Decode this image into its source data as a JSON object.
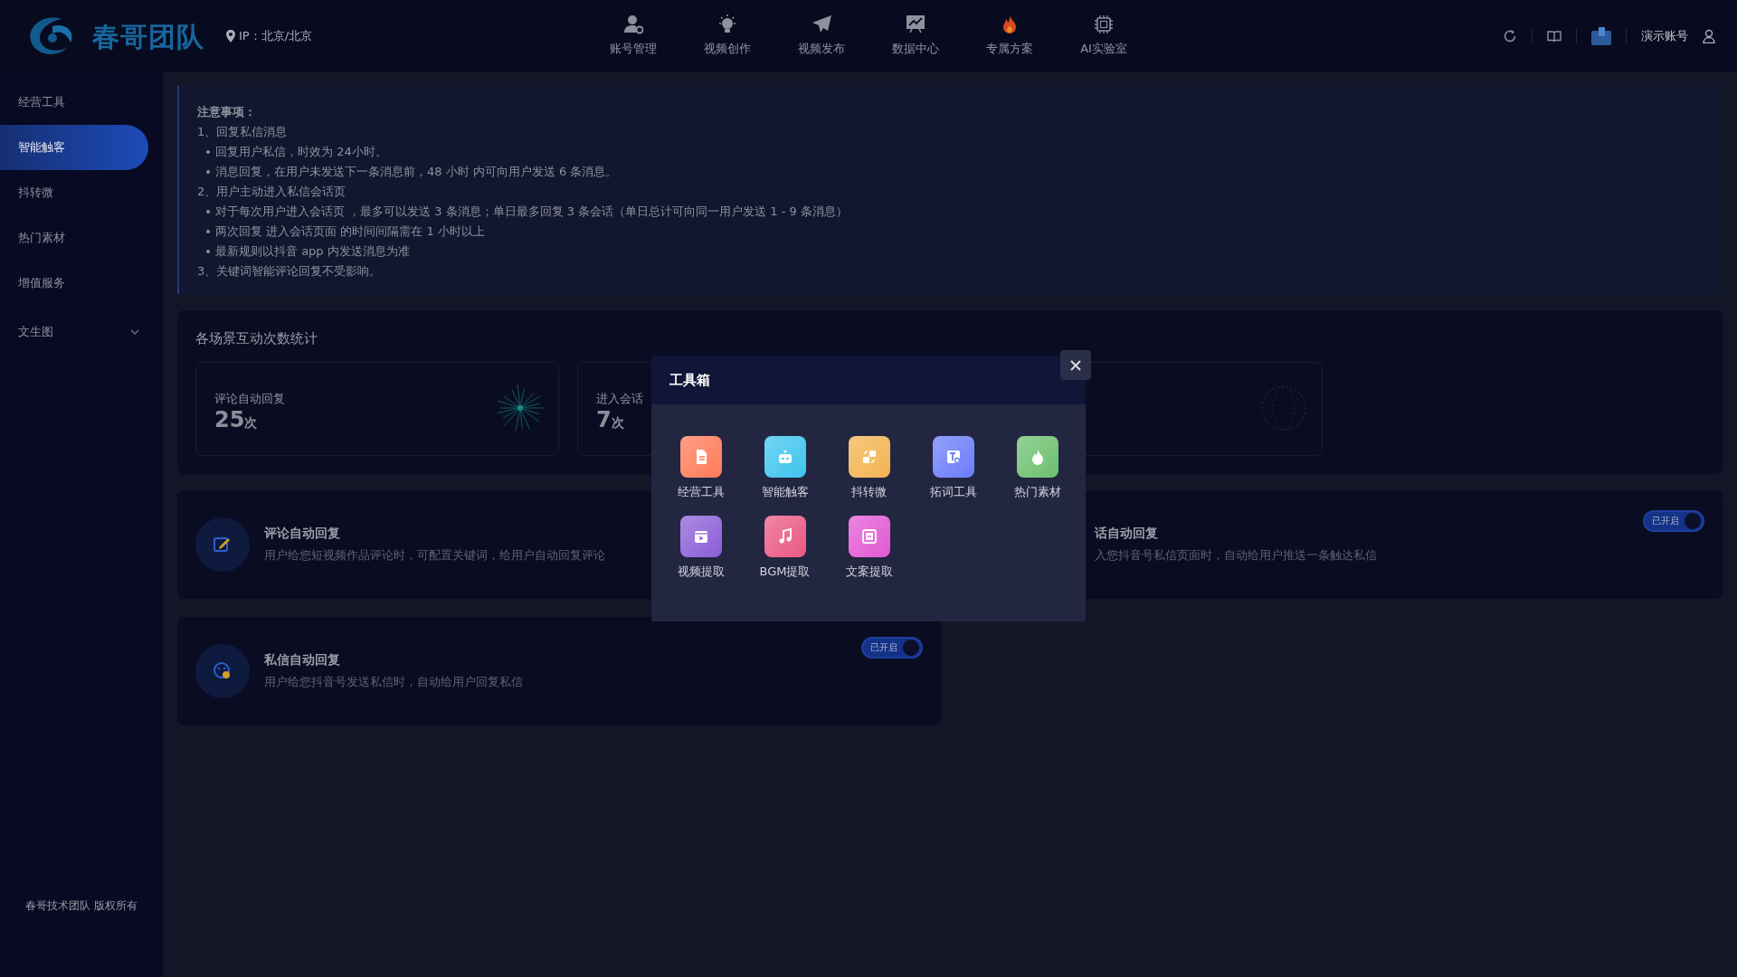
{
  "header": {
    "logo_text": "春哥团队",
    "ip": "IP：北京/北京",
    "nav": [
      {
        "label": "账号管理"
      },
      {
        "label": "视频创作"
      },
      {
        "label": "视频发布"
      },
      {
        "label": "数据中心"
      },
      {
        "label": "专属方案"
      },
      {
        "label": "AI实验室"
      }
    ],
    "account": "演示账号"
  },
  "sidebar": {
    "items": [
      {
        "label": "经营工具",
        "selected": false
      },
      {
        "label": "智能触客",
        "selected": true
      },
      {
        "label": "抖转微",
        "selected": false
      },
      {
        "label": "热门素材",
        "selected": false
      },
      {
        "label": "增值服务",
        "selected": false
      },
      {
        "label": "文生图",
        "selected": false,
        "expanded": false
      }
    ],
    "footer": "春哥技术团队 版权所有"
  },
  "notice": {
    "title": "注意事项：",
    "lines": [
      {
        "kind": "heading",
        "text": "1、回复私信消息"
      },
      {
        "kind": "bullet",
        "text": "回复用户私信，时效为 24小时。"
      },
      {
        "kind": "bullet",
        "text": "消息回复，在用户未发送下一条消息前，48 小时 内可向用户发送 6 条消息。"
      },
      {
        "kind": "heading",
        "text": "2、用户主动进入私信会话页"
      },
      {
        "kind": "bullet",
        "text": "对于每次用户进入会话页 ，最多可以发送 3 条消息；单日最多回复 3 条会话（单日总计可向同一用户发送 1 - 9 条消息）"
      },
      {
        "kind": "bullet",
        "text": "两次回复 进入会话页面 的时间间隔需在 1 小时以上"
      },
      {
        "kind": "bullet",
        "text": "最新规则以抖音 app 内发送消息为准"
      },
      {
        "kind": "heading",
        "text": "3、关键词智能评论回复不受影响。"
      }
    ]
  },
  "stats": {
    "title": "各场景互动次数统计",
    "cards": [
      {
        "kind": "sparkle",
        "label": "评论自动回复",
        "value": "25",
        "unit": "次"
      },
      {
        "kind": "plain",
        "label": "进入会话",
        "value": "7",
        "unit": "次"
      },
      {
        "kind": "globe"
      }
    ]
  },
  "features": [
    {
      "kind": "comment",
      "title": "评论自动回复",
      "description": "用户给您短视频作品评论时，可配置关键词，给用户自动回复评论"
    },
    {
      "kind": "partial",
      "title": "话自动回复",
      "description": "入您抖音号私信页面时，自动给用户推送一条触达私信",
      "toggle": {
        "label": "已开启",
        "on": true
      }
    },
    {
      "kind": "message",
      "title": "私信自动回复",
      "description": "用户给您抖音号发送私信时，自动给用户回复私信",
      "toggle": {
        "label": "已开启",
        "on": true
      }
    }
  ],
  "modal": {
    "title": "工具箱",
    "tools": [
      {
        "label": "经营工具",
        "color": "#ff7a58"
      },
      {
        "label": "智能触客",
        "color": "#3ec4ee"
      },
      {
        "label": "抖转微",
        "color": "#f2b350"
      },
      {
        "label": "拓词工具",
        "color": "#6b7cfa"
      },
      {
        "label": "热门素材",
        "color": "#6cbf6e"
      },
      {
        "label": "视频提取",
        "color": "#8b5ed6"
      },
      {
        "label": "BGM提取",
        "color": "#ea5884"
      },
      {
        "label": "文案提取",
        "color": "#e258d4"
      }
    ]
  }
}
